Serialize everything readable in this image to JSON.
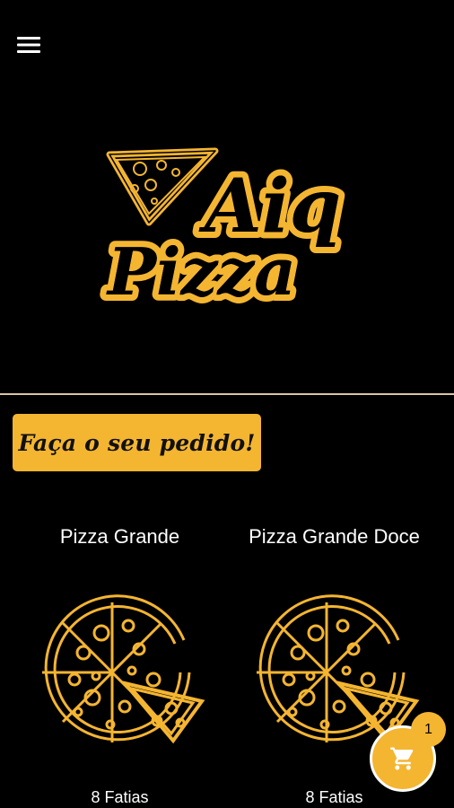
{
  "header": {
    "menu_icon": "hamburger-menu-icon"
  },
  "logo": {
    "line1": "Aiq",
    "line2": "Pizza"
  },
  "order_button": {
    "label": "Faça o seu pedido!"
  },
  "products": [
    {
      "title": "Pizza Grande",
      "slices": "8 Fatias",
      "icon": "pizza-icon"
    },
    {
      "title": "Pizza Grande Doce",
      "slices": "8 Fatias",
      "icon": "pizza-icon"
    }
  ],
  "cart": {
    "icon": "shopping-cart-icon",
    "count": "1"
  },
  "colors": {
    "background": "#000000",
    "accent": "#f4b531",
    "divider": "#d9c7a0",
    "text": "#ffffff"
  }
}
